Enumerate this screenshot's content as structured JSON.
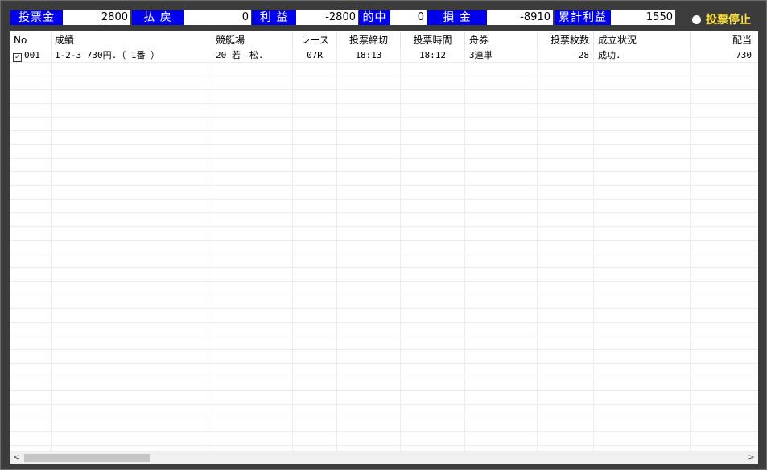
{
  "stats": {
    "bet_amount": {
      "label": "投票金",
      "value": "2800"
    },
    "payout": {
      "label": "払 戻",
      "value": "0"
    },
    "profit": {
      "label": "利 益",
      "value": "-2800"
    },
    "hits": {
      "label": "的中",
      "value": "0"
    },
    "loss": {
      "label": "損 金",
      "value": "-8910"
    },
    "cumulative_profit": {
      "label": "累計利益",
      "value": "1550"
    }
  },
  "status": {
    "label": "投票停止",
    "dot_color": "#ffffff",
    "label_color": "#ffe23a"
  },
  "colors": {
    "label_bg": "#0000ee",
    "value_bg": "#ffffff",
    "window_bg": "#3c3c3c"
  },
  "table": {
    "columns": [
      "No",
      "成績",
      "競艇場",
      "レース",
      "投票締切",
      "投票時間",
      "舟券",
      "投票枚数",
      "成立状況",
      "配当"
    ],
    "rows": [
      {
        "checked": true,
        "no": "001",
        "result": "1-2-3 730円.（ 1番 ）",
        "venue": "20 若　松.",
        "race": "07R",
        "deadline": "18:13",
        "bet_time": "18:12",
        "ticket_type": "3連単",
        "ticket_count": "28",
        "status": "成功.",
        "payout": "730"
      }
    ]
  },
  "scrollbar": {
    "left_arrow": "<",
    "right_arrow": ">"
  }
}
